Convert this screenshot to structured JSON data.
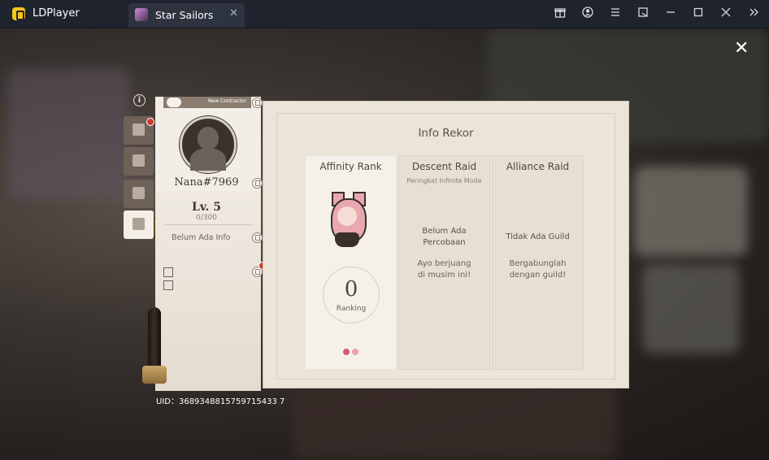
{
  "window": {
    "app_name": "LDPlayer",
    "tab": {
      "label": "Star Sailors",
      "close_glyph": "✕"
    },
    "controls": [
      "gift-box-icon",
      "account-icon",
      "menu-icon",
      "popout-icon",
      "minimize-icon",
      "maximize-icon",
      "close-icon",
      "expand-sidebar-icon"
    ]
  },
  "game": {
    "close_glyph": "✕",
    "info_glyph": "i",
    "profile": {
      "badge_label": "New Contractor",
      "nickname": "Nana#7969",
      "level": "Lv. 5",
      "exp": "0/300",
      "intro": "Belum Ada Info",
      "uid": "UID : 3689348815759715433 7",
      "uid_text": "UID：3689348815759715433 7"
    },
    "panel": {
      "title": "Info Rekor",
      "columns": [
        {
          "title": "Affinity Rank",
          "rank_value": "0",
          "rank_label": "Ranking"
        },
        {
          "title": "Descent Raid",
          "subtitle": "Peringkat Infinite Mode",
          "status": "Belum Ada Percobaan",
          "hint": "Ayo berjuang di musim ini!"
        },
        {
          "title": "Alliance Raid",
          "status": "Tidak Ada Guild",
          "hint": "Bergabunglah dengan guild!"
        }
      ]
    },
    "colors": {
      "accent_red": "#d23a2a",
      "panel_bg": "#ebe4d9"
    }
  }
}
